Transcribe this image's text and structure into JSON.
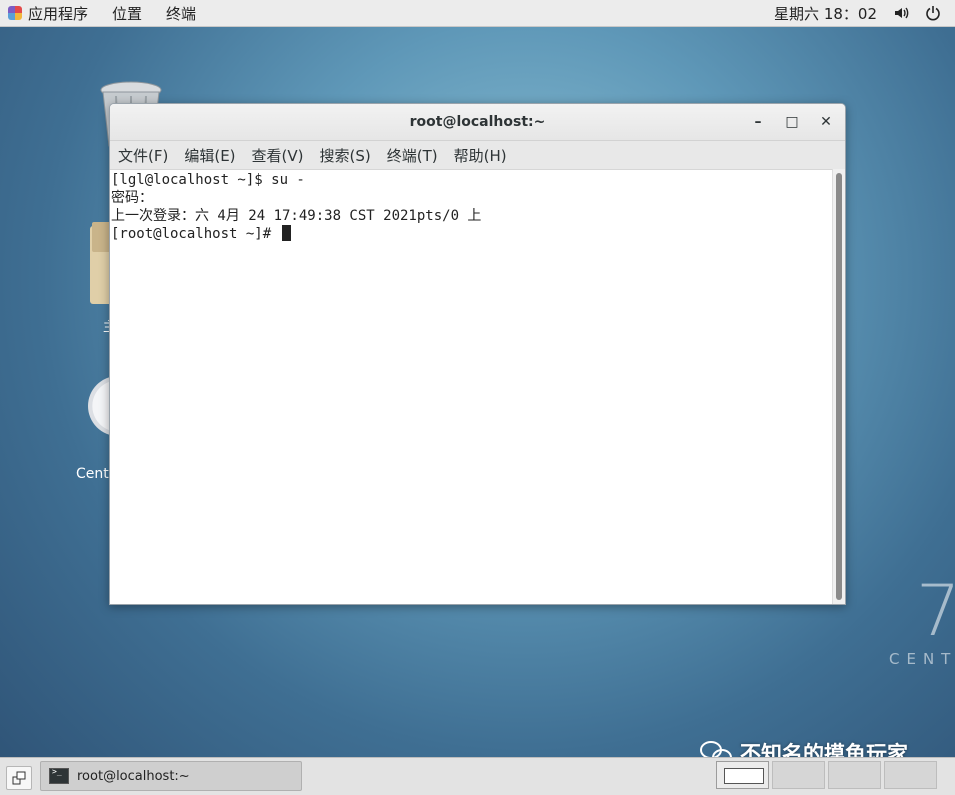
{
  "topbar": {
    "applications": "应用程序",
    "places": "位置",
    "terminal": "终端",
    "clock": "星期六 18：02",
    "volume_icon": "volume-icon",
    "power_icon": "power-icon"
  },
  "desktop": {
    "folder_label": "主",
    "disc_label": "CentO",
    "brand_number": "7",
    "brand_text": "CENT"
  },
  "window": {
    "title": "root@localhost:~",
    "minimize": "–",
    "maximize": "□",
    "close": "✕",
    "menu": [
      "文件(F)",
      "编辑(E)",
      "查看(V)",
      "搜索(S)",
      "终端(T)",
      "帮助(H)"
    ]
  },
  "terminal": {
    "lines": [
      "[lgl@localhost ~]$ su -",
      "密码：",
      "上一次登录：六 4月 24 17:49:38 CST 2021pts/0 上",
      "[root@localhost ~]# "
    ]
  },
  "watermark": {
    "text": "不知名的摸鱼玩家"
  },
  "taskbar": {
    "task_label": "root@localhost:~",
    "workspaces": 4
  }
}
